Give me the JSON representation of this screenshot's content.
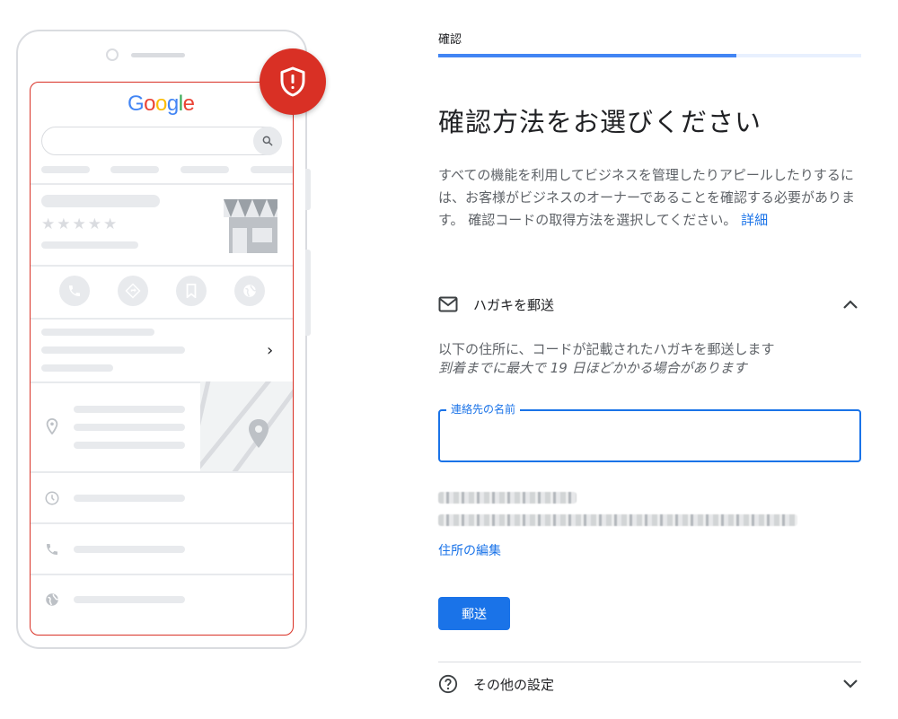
{
  "illustration": {
    "logo_text": "Google",
    "stars": "★★★★★",
    "chevron": "›",
    "badge_icon": "shield-alert-icon"
  },
  "progress": {
    "label": "確認",
    "percent": 70.5
  },
  "title": "確認方法をお選びください",
  "description": {
    "text": "すべての機能を利用してビジネスを管理したりアピールしたりするには、お客様がビジネスのオーナーであることを確認する必要があります。 確認コードの取得方法を選択してください。",
    "link": "詳細"
  },
  "postcard_option": {
    "icon": "envelope-icon",
    "label": "ハガキを郵送",
    "note_line1": "以下の住所に、コードが記載されたハガキを郵送します",
    "note_line2": "到着までに最大で 19 日ほどかかる場合があります",
    "field_label": "連絡先の名前",
    "field_value": "",
    "edit_address_link": "住所の編集",
    "send_button": "郵送"
  },
  "other_settings": {
    "icon": "help-circle-icon",
    "label": "その他の設定"
  },
  "colors": {
    "primary": "#1a73e8",
    "progress": "#4285f4",
    "progress_track": "#e8f0fe",
    "alert": "#d93025"
  }
}
